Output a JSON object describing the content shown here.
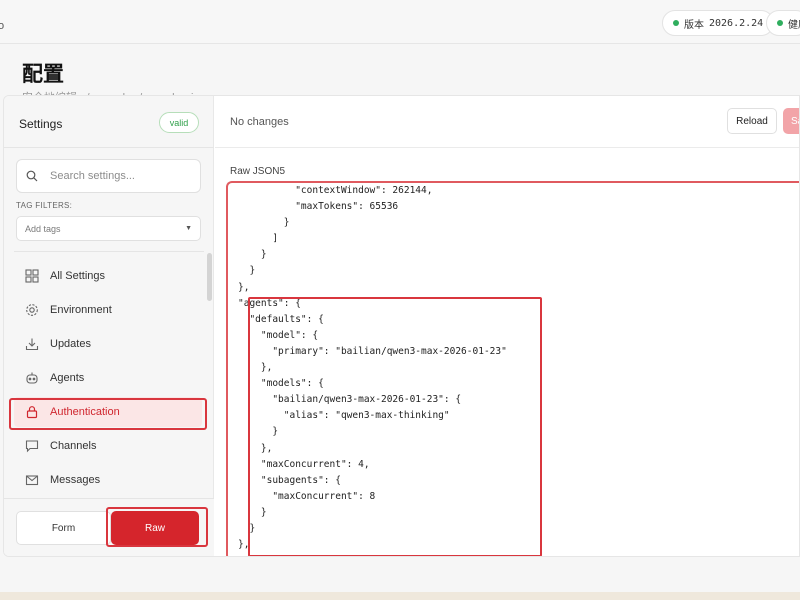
{
  "topbar": {
    "edge_char": "o",
    "version_label": "版本",
    "version_value": "2026.2.24",
    "health_label": "健康"
  },
  "page": {
    "title": "配置",
    "subtitle": "安全地编辑 ~/.openclaw/openclaw.json"
  },
  "sidebar": {
    "title": "Settings",
    "valid_badge": "valid",
    "search_placeholder": "Search settings...",
    "tag_filters_label": "TAG FILTERS:",
    "tag_select_placeholder": "Add tags",
    "items": [
      {
        "label": "All Settings",
        "icon": "grid-icon"
      },
      {
        "label": "Environment",
        "icon": "gear-icon"
      },
      {
        "label": "Updates",
        "icon": "download-icon"
      },
      {
        "label": "Agents",
        "icon": "robot-icon"
      },
      {
        "label": "Authentication",
        "icon": "lock-icon",
        "active": true
      },
      {
        "label": "Channels",
        "icon": "chat-icon"
      },
      {
        "label": "Messages",
        "icon": "mail-icon"
      }
    ],
    "mode_form": "Form",
    "mode_raw": "Raw"
  },
  "editor_header": {
    "status": "No changes",
    "reload": "Reload",
    "save": "Save"
  },
  "editor": {
    "label": "Raw JSON5",
    "lines": [
      "          \"contextWindow\": 262144,",
      "          \"maxTokens\": 65536",
      "        }",
      "      ]",
      "    }",
      "  }",
      "},",
      "\"agents\": {",
      "  \"defaults\": {",
      "    \"model\": {",
      "      \"primary\": \"bailian/qwen3-max-2026-01-23\"",
      "    },",
      "    \"models\": {",
      "      \"bailian/qwen3-max-2026-01-23\": {",
      "        \"alias\": \"qwen3-max-thinking\"",
      "      }",
      "    },",
      "    \"maxConcurrent\": 4,",
      "    \"subagents\": {",
      "      \"maxConcurrent\": 8",
      "    }",
      "  }",
      "},"
    ]
  },
  "colors": {
    "accent": "#d5252c",
    "valid_green": "#2fa04a",
    "annotation_red": "#d9363e"
  }
}
